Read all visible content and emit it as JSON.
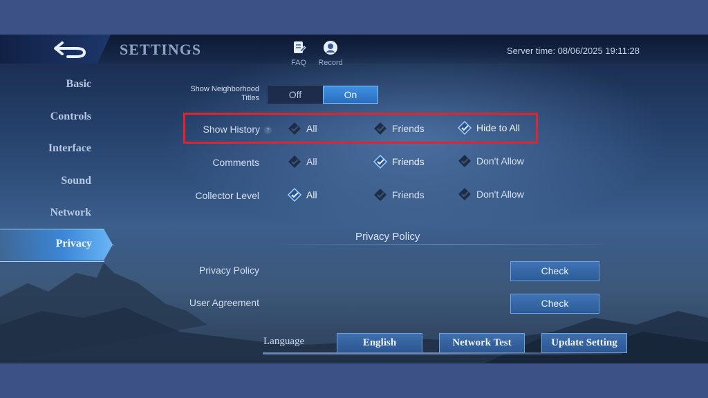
{
  "header": {
    "title": "SETTINGS",
    "faq_label": "FAQ",
    "record_label": "Record",
    "server_time": "Server time: 08/06/2025 19:11:28"
  },
  "sidebar": {
    "items": [
      {
        "label": "Basic"
      },
      {
        "label": "Controls"
      },
      {
        "label": "Interface"
      },
      {
        "label": "Sound"
      },
      {
        "label": "Network"
      },
      {
        "label": "Privacy",
        "active": true
      }
    ]
  },
  "neighborhood": {
    "label_line1": "Show Neighborhood",
    "label_line2": "Titles",
    "off_label": "Off",
    "on_label": "On",
    "selected": "On"
  },
  "privacy_rows": [
    {
      "label": "Show History",
      "help": "?",
      "options": [
        "All",
        "Friends",
        "Hide to All"
      ],
      "selected": "Hide to All"
    },
    {
      "label": "Comments",
      "options": [
        "All",
        "Friends",
        "Don't Allow"
      ],
      "selected": "Friends"
    },
    {
      "label": "Collector Level",
      "options": [
        "All",
        "Friends",
        "Don't Allow"
      ],
      "selected": "All"
    }
  ],
  "policy": {
    "section_title": "Privacy Policy",
    "privacy_label": "Privacy Policy",
    "agreement_label": "User Agreement",
    "check_label": "Check"
  },
  "footer": {
    "language_label": "Language",
    "language_value": "English",
    "network_test": "Network Test",
    "update_setting": "Update Setting"
  },
  "colors": {
    "accent": "#3b86d6",
    "highlight": "#e0262c",
    "background": "#3c5286"
  },
  "icons": {
    "back": "back-arrow-icon",
    "faq": "faq-icon",
    "record": "record-icon",
    "option_selected": "checkmark-diamond-icon",
    "option_unselected": "diamond-icon"
  }
}
